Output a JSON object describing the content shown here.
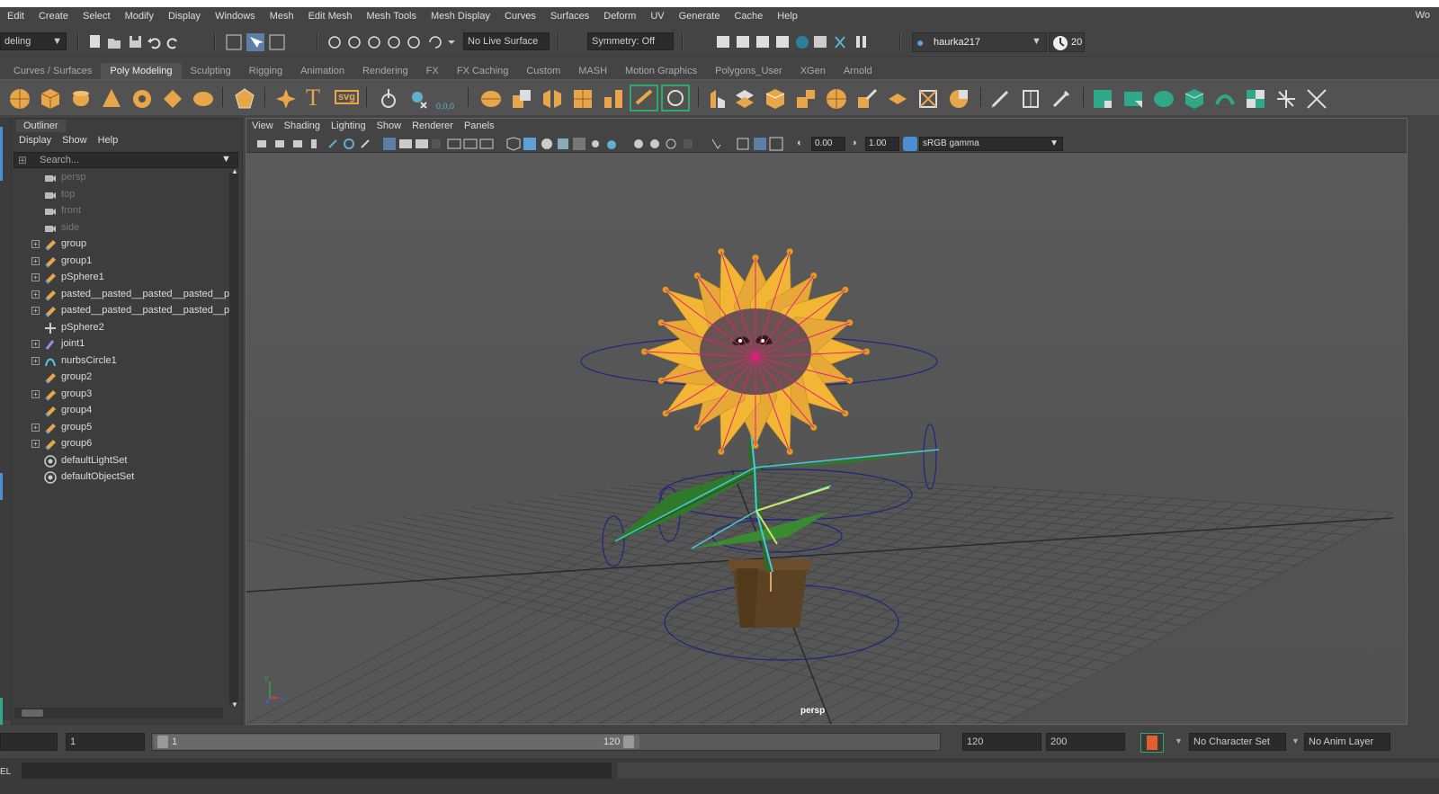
{
  "menubar": {
    "items": [
      "Edit",
      "Create",
      "Select",
      "Modify",
      "Display",
      "Windows",
      "Mesh",
      "Edit Mesh",
      "Mesh Tools",
      "Mesh Display",
      "Curves",
      "Surfaces",
      "Deform",
      "UV",
      "Generate",
      "Cache",
      "Help"
    ],
    "right_text": "Wo"
  },
  "statusline": {
    "menuset": "deling",
    "live_surface": "No Live Surface",
    "symmetry": "Symmetry: Off",
    "user": "haurka217",
    "notifications": "20"
  },
  "shelf": {
    "tabs": [
      "Curves / Surfaces",
      "Poly Modeling",
      "Sculpting",
      "Rigging",
      "Animation",
      "Rendering",
      "FX",
      "FX Caching",
      "Custom",
      "MASH",
      "Motion Graphics",
      "Polygons_User",
      "XGen",
      "Arnold"
    ],
    "active_tab": "Poly Modeling",
    "text_icon": "T",
    "svg_icon": "svg",
    "coord_icon": "0,0,0"
  },
  "outliner": {
    "title": "Outliner",
    "menus": [
      "Display",
      "Show",
      "Help"
    ],
    "search_placeholder": "Search...",
    "items": [
      {
        "label": "persp",
        "type": "camera",
        "expandable": false
      },
      {
        "label": "top",
        "type": "camera",
        "expandable": false
      },
      {
        "label": "front",
        "type": "camera",
        "expandable": false
      },
      {
        "label": "side",
        "type": "camera",
        "expandable": false
      },
      {
        "label": "group",
        "type": "transform",
        "expandable": true
      },
      {
        "label": "group1",
        "type": "transform",
        "expandable": true
      },
      {
        "label": "pSphere1",
        "type": "transform",
        "expandable": true
      },
      {
        "label": "pasted__pasted__pasted__pasted__pa",
        "type": "transform",
        "expandable": true
      },
      {
        "label": "pasted__pasted__pasted__pasted__pa",
        "type": "transform",
        "expandable": true
      },
      {
        "label": "pSphere2",
        "type": "mesh",
        "expandable": false
      },
      {
        "label": "joint1",
        "type": "joint",
        "expandable": true
      },
      {
        "label": "nurbsCircle1",
        "type": "curve",
        "expandable": true
      },
      {
        "label": "group2",
        "type": "transform",
        "expandable": false
      },
      {
        "label": "group3",
        "type": "transform",
        "expandable": true
      },
      {
        "label": "group4",
        "type": "transform",
        "expandable": false
      },
      {
        "label": "group5",
        "type": "transform",
        "expandable": true
      },
      {
        "label": "group6",
        "type": "transform",
        "expandable": true
      },
      {
        "label": "defaultLightSet",
        "type": "set",
        "expandable": false
      },
      {
        "label": "defaultObjectSet",
        "type": "set",
        "expandable": false
      }
    ]
  },
  "viewport": {
    "menus": [
      "View",
      "Shading",
      "Lighting",
      "Show",
      "Renderer",
      "Panels"
    ],
    "exposure": "0.00",
    "gamma": "1.00",
    "colorspace": "sRGB gamma",
    "camera_label": "persp"
  },
  "timeline": {
    "current_frame": "1",
    "range_start": "1",
    "range_end_inner": "120",
    "anim_end": "120",
    "anim_max": "200",
    "character_set": "No Character Set",
    "anim_layer": "No Anim Layer"
  },
  "cmdline": {
    "label": "EL"
  },
  "colors": {
    "shelf_orange": "#e8a64a",
    "shelf_green": "#2fa88a",
    "petal": "#f3b634",
    "stem": "#2f7a2a",
    "joint": "#48c8e0",
    "control": "#23237e"
  }
}
